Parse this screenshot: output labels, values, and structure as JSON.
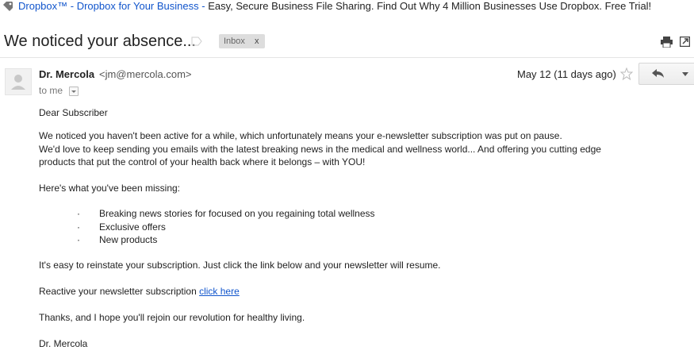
{
  "ad": {
    "link_text": "Dropbox™ - Dropbox for Your Business",
    "separator": " - ",
    "description": "Easy, Secure Business File Sharing. Find Out Why 4 Million Businesses Use Dropbox. Free Trial!"
  },
  "email": {
    "subject": "We noticed your absence...",
    "label": "Inbox",
    "label_remove": "x",
    "sender_name": "Dr. Mercola",
    "sender_email": "<jm@mercola.com>",
    "recipient": "to me",
    "date": "May 12 (11 days ago)",
    "body": {
      "greeting": "Dear Subscriber",
      "p1_line1": "We noticed you haven't been active for a while, which unfortunately means your e-newsletter subscription was put on pause.",
      "p1_line2": "We'd love to keep sending you emails with the latest breaking news in the medical and wellness world... And offering you cutting edge",
      "p1_line3": "products that put the control of your health back where it belongs – with YOU!",
      "missing_intro": "Here's what you've been missing:",
      "bullet_char": "·",
      "bullets": [
        "Breaking news stories for focused on you regaining total wellness",
        "Exclusive offers",
        "New products"
      ],
      "reinstate": "It's easy to reinstate your subscription. Just click the link below and your newsletter will resume.",
      "reactive_prefix": "Reactive your newsletter subscription ",
      "reactive_link": "click here",
      "thanks": "Thanks, and I hope you'll rejoin our revolution for healthy living.",
      "signature": "Dr. Mercola"
    }
  },
  "icons": {
    "ad": "tag-icon",
    "label": "label-icon",
    "print": "print-icon",
    "new_window": "new-window-icon",
    "avatar": "avatar-icon",
    "star": "star-icon",
    "reply": "reply-icon",
    "more": "chevron-down-icon"
  },
  "colors": {
    "link": "#1155cc",
    "badge_bg": "#dddddd"
  }
}
